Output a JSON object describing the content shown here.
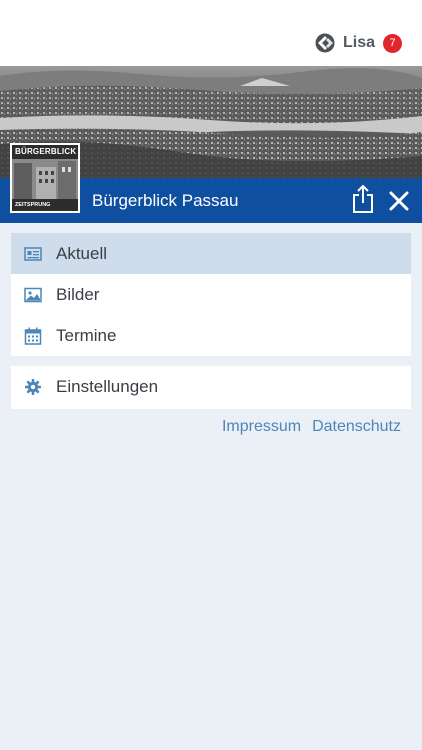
{
  "header": {
    "username": "Lisa",
    "notification_count": "7",
    "brand_icon": "app-logo-icon"
  },
  "hero": {
    "title": "Bürgerblick Passau",
    "thumbnail_top_text": "BÜRGERBLICK",
    "thumbnail_bottom_text": "ZEITSPRUNG",
    "share_icon": "share-icon",
    "close_icon": "close-icon"
  },
  "menu": {
    "items": [
      {
        "label": "Aktuell",
        "icon": "news-icon",
        "active": true
      },
      {
        "label": "Bilder",
        "icon": "image-icon",
        "active": false
      },
      {
        "label": "Termine",
        "icon": "calendar-icon",
        "active": false
      }
    ],
    "settings": {
      "label": "Einstellungen",
      "icon": "gear-icon"
    }
  },
  "footer": {
    "impressum": "Impressum",
    "datenschutz": "Datenschutz"
  },
  "colors": {
    "accent": "#0f4fa0",
    "active_bg": "#cfdcec",
    "link": "#4d86b8",
    "badge": "#e0262b",
    "background": "#ebf0f7"
  }
}
